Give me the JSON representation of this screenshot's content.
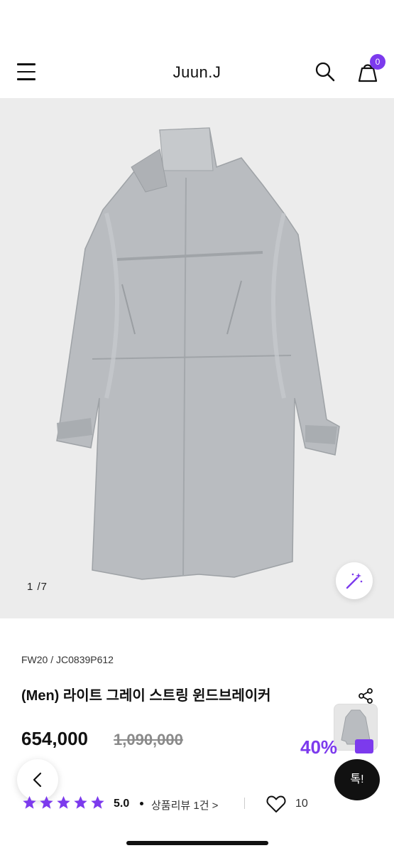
{
  "header": {
    "brand": "Juun.J",
    "cart_count": "0",
    "icons": [
      "menu-icon",
      "search-icon",
      "cart-icon"
    ]
  },
  "gallery": {
    "counter": "1  /7",
    "icons": [
      "magic-wand-icon"
    ]
  },
  "product": {
    "code": "FW20 / JC0839P612",
    "title": "(Men) 라이트 그레이 스트링 윈드브레이커",
    "price": "654,000",
    "original_price": "1,090,000",
    "discount": "40%",
    "rating": "5.0",
    "stars": 5,
    "review_link": "상품리뷰 1건 >",
    "likes": "10"
  },
  "floating": {
    "chat_label": "톡!",
    "icons": [
      "back-arrow-icon",
      "share-icon",
      "heart-icon"
    ]
  },
  "colors": {
    "accent": "#7c3aed",
    "hero_bg": "#ececec",
    "coat": "#b9bcc0"
  }
}
